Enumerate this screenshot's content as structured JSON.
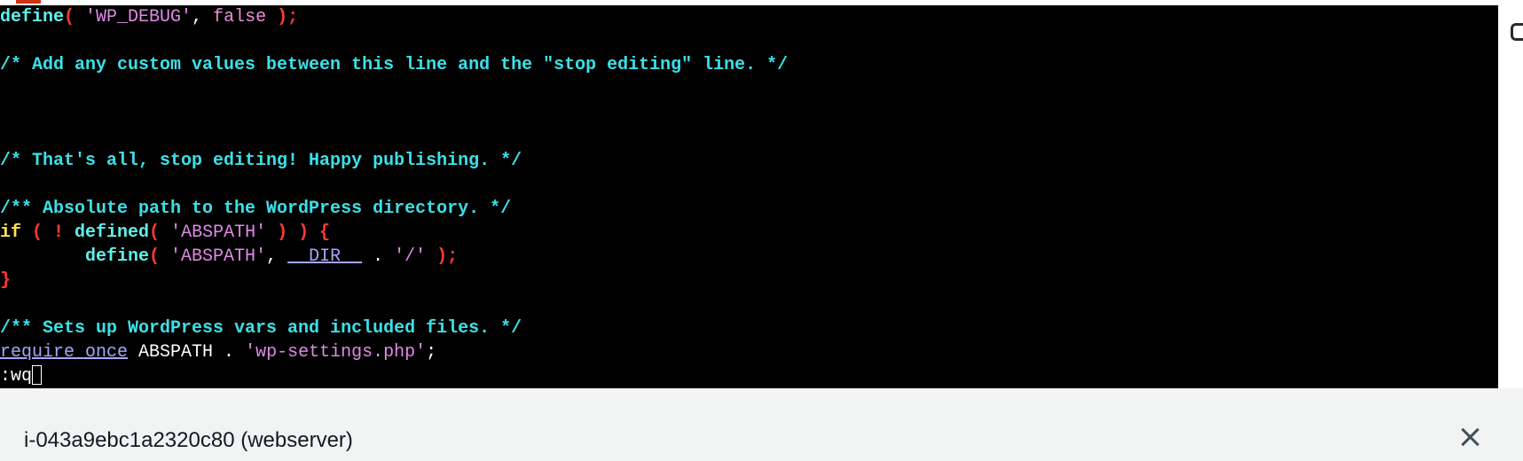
{
  "terminal": {
    "lines": [
      [
        {
          "t": "define",
          "c": "func"
        },
        {
          "t": "( ",
          "c": "paren"
        },
        {
          "t": "'WP_DEBUG'",
          "c": "str"
        },
        {
          "t": ", ",
          "c": "plain"
        },
        {
          "t": "false",
          "c": "const"
        },
        {
          "t": " );",
          "c": "paren"
        }
      ],
      [],
      [
        {
          "t": "/* Add any custom values between this line and the \"stop editing\" line. */",
          "c": "comment"
        }
      ],
      [],
      [],
      [],
      [
        {
          "t": "/* That's all, stop editing! Happy publishing. */",
          "c": "comment"
        }
      ],
      [],
      [
        {
          "t": "/** Absolute path to the WordPress directory. */",
          "c": "comment"
        }
      ],
      [
        {
          "t": "if",
          "c": "keyword"
        },
        {
          "t": " ( ! ",
          "c": "paren"
        },
        {
          "t": "defined",
          "c": "func"
        },
        {
          "t": "( ",
          "c": "paren"
        },
        {
          "t": "'ABSPATH'",
          "c": "str"
        },
        {
          "t": " ) ) {",
          "c": "paren"
        }
      ],
      [
        {
          "t": "        define",
          "c": "func"
        },
        {
          "t": "( ",
          "c": "paren"
        },
        {
          "t": "'ABSPATH'",
          "c": "str"
        },
        {
          "t": ", ",
          "c": "plain"
        },
        {
          "t": "__DIR__",
          "c": "req"
        },
        {
          "t": " . ",
          "c": "plain"
        },
        {
          "t": "'/'",
          "c": "str"
        },
        {
          "t": " );",
          "c": "paren"
        }
      ],
      [
        {
          "t": "}",
          "c": "paren"
        }
      ],
      [],
      [
        {
          "t": "/** Sets up WordPress vars and included files. */",
          "c": "comment"
        }
      ],
      [
        {
          "t": "require_once",
          "c": "req"
        },
        {
          "t": " ABSPATH . ",
          "c": "plain"
        },
        {
          "t": "'wp-settings.php'",
          "c": "str"
        },
        {
          "t": ";",
          "c": "plain"
        }
      ],
      [
        {
          "t": ":wq",
          "c": "plain"
        }
      ]
    ]
  },
  "footer": {
    "instance_label": "i-043a9ebc1a2320c80 (webserver)"
  },
  "icons": {
    "close": "close-icon",
    "edge": "panel-edge-icon"
  }
}
